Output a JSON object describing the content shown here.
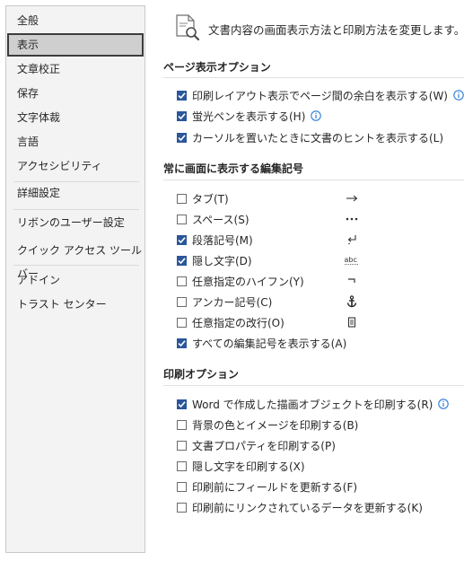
{
  "sidebar": {
    "items": [
      {
        "label": "全般"
      },
      {
        "label": "表示"
      },
      {
        "label": "文章校正"
      },
      {
        "label": "保存"
      },
      {
        "label": "文字体裁"
      },
      {
        "label": "言語"
      },
      {
        "label": "アクセシビリティ"
      },
      {
        "label": "詳細設定"
      },
      {
        "label": "リボンのユーザー設定"
      },
      {
        "label": "クイック アクセス ツール バー"
      },
      {
        "label": "アドイン"
      },
      {
        "label": "トラスト センター"
      }
    ],
    "selected": "表示"
  },
  "main": {
    "intro": "文書内容の画面表示方法と印刷方法を変更します。",
    "page_display": {
      "title": "ページ表示オプション",
      "options": [
        {
          "label": "印刷レイアウト表示でページ間の余白を表示する(W)",
          "checked": true,
          "info": true
        },
        {
          "label": "蛍光ペンを表示する(H)",
          "checked": true,
          "info": true
        },
        {
          "label": "カーソルを置いたときに文書のヒントを表示する(L)",
          "checked": true,
          "info": false
        }
      ]
    },
    "format_marks": {
      "title": "常に画面に表示する編集記号",
      "options": [
        {
          "label": "タブ(T)",
          "checked": false,
          "mark": "→"
        },
        {
          "label": "スペース(S)",
          "checked": false,
          "mark": "•••"
        },
        {
          "label": "段落記号(M)",
          "checked": true,
          "mark": "↵"
        },
        {
          "label": "隠し文字(D)",
          "checked": true,
          "mark": "abc"
        },
        {
          "label": "任意指定のハイフン(Y)",
          "checked": false,
          "mark": "¬"
        },
        {
          "label": "アンカー記号(C)",
          "checked": false,
          "mark": "⚓"
        },
        {
          "label": "任意指定の改行(O)",
          "checked": false,
          "mark": "▯"
        },
        {
          "label": "すべての編集記号を表示する(A)",
          "checked": true
        }
      ]
    },
    "print_options": {
      "title": "印刷オプション",
      "options": [
        {
          "label": "Word で作成した描画オブジェクトを印刷する(R)",
          "checked": true,
          "info": true
        },
        {
          "label": "背景の色とイメージを印刷する(B)",
          "checked": false
        },
        {
          "label": "文書プロパティを印刷する(P)",
          "checked": false
        },
        {
          "label": "隠し文字を印刷する(X)",
          "checked": false
        },
        {
          "label": "印刷前にフィールドを更新する(F)",
          "checked": false
        },
        {
          "label": "印刷前にリンクされているデータを更新する(K)",
          "checked": false
        }
      ]
    }
  },
  "colors": {
    "accent": "#2b579a",
    "info": "#2b7bd8"
  }
}
